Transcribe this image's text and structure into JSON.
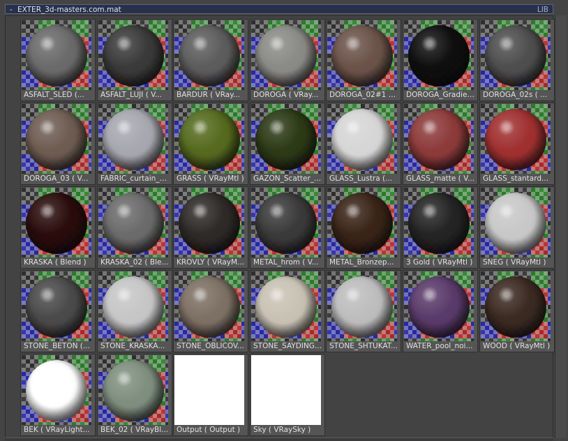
{
  "title_bar": {
    "collapse_symbol": "-",
    "title": "EXTER_3d-masters.com.mat",
    "lib_label": "LIB"
  },
  "materials": [
    {
      "label": "ASFALT_SLED  (...",
      "sphere": "#6a6a6a"
    },
    {
      "label": "ASFALT_LUJI  ( V...",
      "sphere": "#3a3a3a"
    },
    {
      "label": "BARDUR  ( VRay...",
      "sphere": "#5c5c5c"
    },
    {
      "label": "DOROGA  ( VRay...",
      "sphere": "#8a8a86"
    },
    {
      "label": "DOROGA_02#1  (...",
      "sphere": "#6b5349"
    },
    {
      "label": "DOROGA_Gradien...",
      "sphere": "#0f0f0f"
    },
    {
      "label": "DOROGA_02s  ( ...",
      "sphere": "#4e4e4e"
    },
    {
      "label": "DOROGA_03  ( V...",
      "sphere": "#6e5c52"
    },
    {
      "label": "FABRIC_curtain_t...",
      "sphere": "#a7a7b0"
    },
    {
      "label": "GRASS  ( VRayMtl )",
      "sphere": "#556a1e"
    },
    {
      "label": "GAZON_Scatter_...",
      "sphere": "#2c3a16"
    },
    {
      "label": "GLASS_Lustra  (...",
      "sphere": "#d6d6d6"
    },
    {
      "label": "GLASS_matte  ( V...",
      "sphere": "#8d3a3a"
    },
    {
      "label": "GLASS_stantard...",
      "sphere": "#a03030"
    },
    {
      "label": "KRASKA  ( Blend )",
      "sphere": "#2a0c0c"
    },
    {
      "label": "KRASKA_02  ( Ble...",
      "sphere": "#6b6b6b"
    },
    {
      "label": "KROVLY  ( VRayM...",
      "sphere": "#2e2a28"
    },
    {
      "label": "METAL_hrom  ( V...",
      "sphere": "#3a3a3a"
    },
    {
      "label": "METAL_Bronzep...",
      "sphere": "#3a2418"
    },
    {
      "label": "3 Gold  ( VRayMtl )",
      "sphere": "#242424"
    },
    {
      "label": "SNEG  ( VRayMtl )",
      "sphere": "#c8c8c8"
    },
    {
      "label": "STONE_BETON  (...",
      "sphere": "#4a4a4a"
    },
    {
      "label": "STONE_KRASKA...",
      "sphere": "#c6c6c6"
    },
    {
      "label": "STONE_OBLICOV...",
      "sphere": "#7d7064"
    },
    {
      "label": "STONE_SAYDING...",
      "sphere": "#c9c2b4"
    },
    {
      "label": "STONE_SHTUKAT...",
      "sphere": "#bdbdbd"
    },
    {
      "label": "WATER_pool_noi...",
      "sphere": "#5a3a6a"
    },
    {
      "label": "WOOD  ( VRayMtl )",
      "sphere": "#3b2a22"
    },
    {
      "label": "BEK  ( VRayLight...",
      "sphere": "#ffffff"
    },
    {
      "label": "BEK_02  ( VRayBl...",
      "sphere": "#7f8f7f"
    },
    {
      "label": "Output  ( Output )",
      "sphere": ""
    },
    {
      "label": "Sky  ( VRaySky )",
      "sphere": ""
    }
  ]
}
